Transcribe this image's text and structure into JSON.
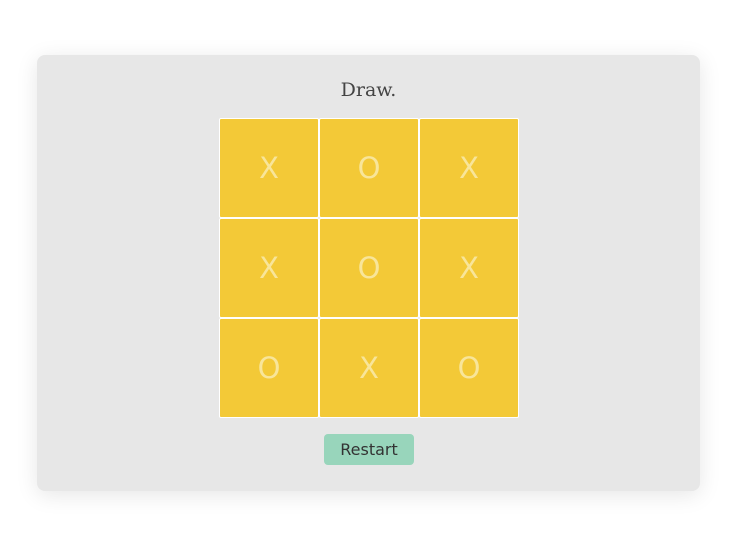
{
  "status": "Draw.",
  "board": {
    "cells": [
      "X",
      "O",
      "X",
      "X",
      "O",
      "X",
      "O",
      "X",
      "O"
    ]
  },
  "restart_label": "Restart",
  "colors": {
    "panel": "#e7e7e7",
    "cell": "#f3c937",
    "mark": "#f8e59a",
    "button": "#98d5bb"
  }
}
